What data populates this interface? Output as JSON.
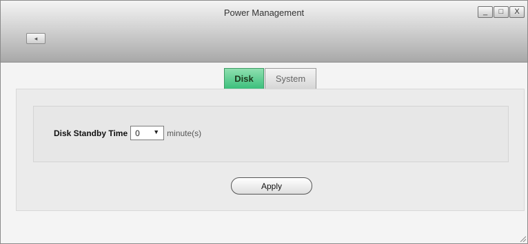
{
  "window": {
    "title": "Power Management",
    "controls": {
      "minimize": "_",
      "maximize": "□",
      "close": "X"
    },
    "back_icon": "◂"
  },
  "tabs": [
    {
      "label": "Disk",
      "active": true
    },
    {
      "label": "System",
      "active": false
    }
  ],
  "disk": {
    "standby_label": "Disk Standby Time",
    "standby_value": "0",
    "dropdown_arrow": "▼",
    "unit": "minute(s)"
  },
  "actions": {
    "apply_label": "Apply"
  },
  "colors": {
    "active_tab": "#3cbf7c",
    "titlebar": "#b8b8b8"
  }
}
